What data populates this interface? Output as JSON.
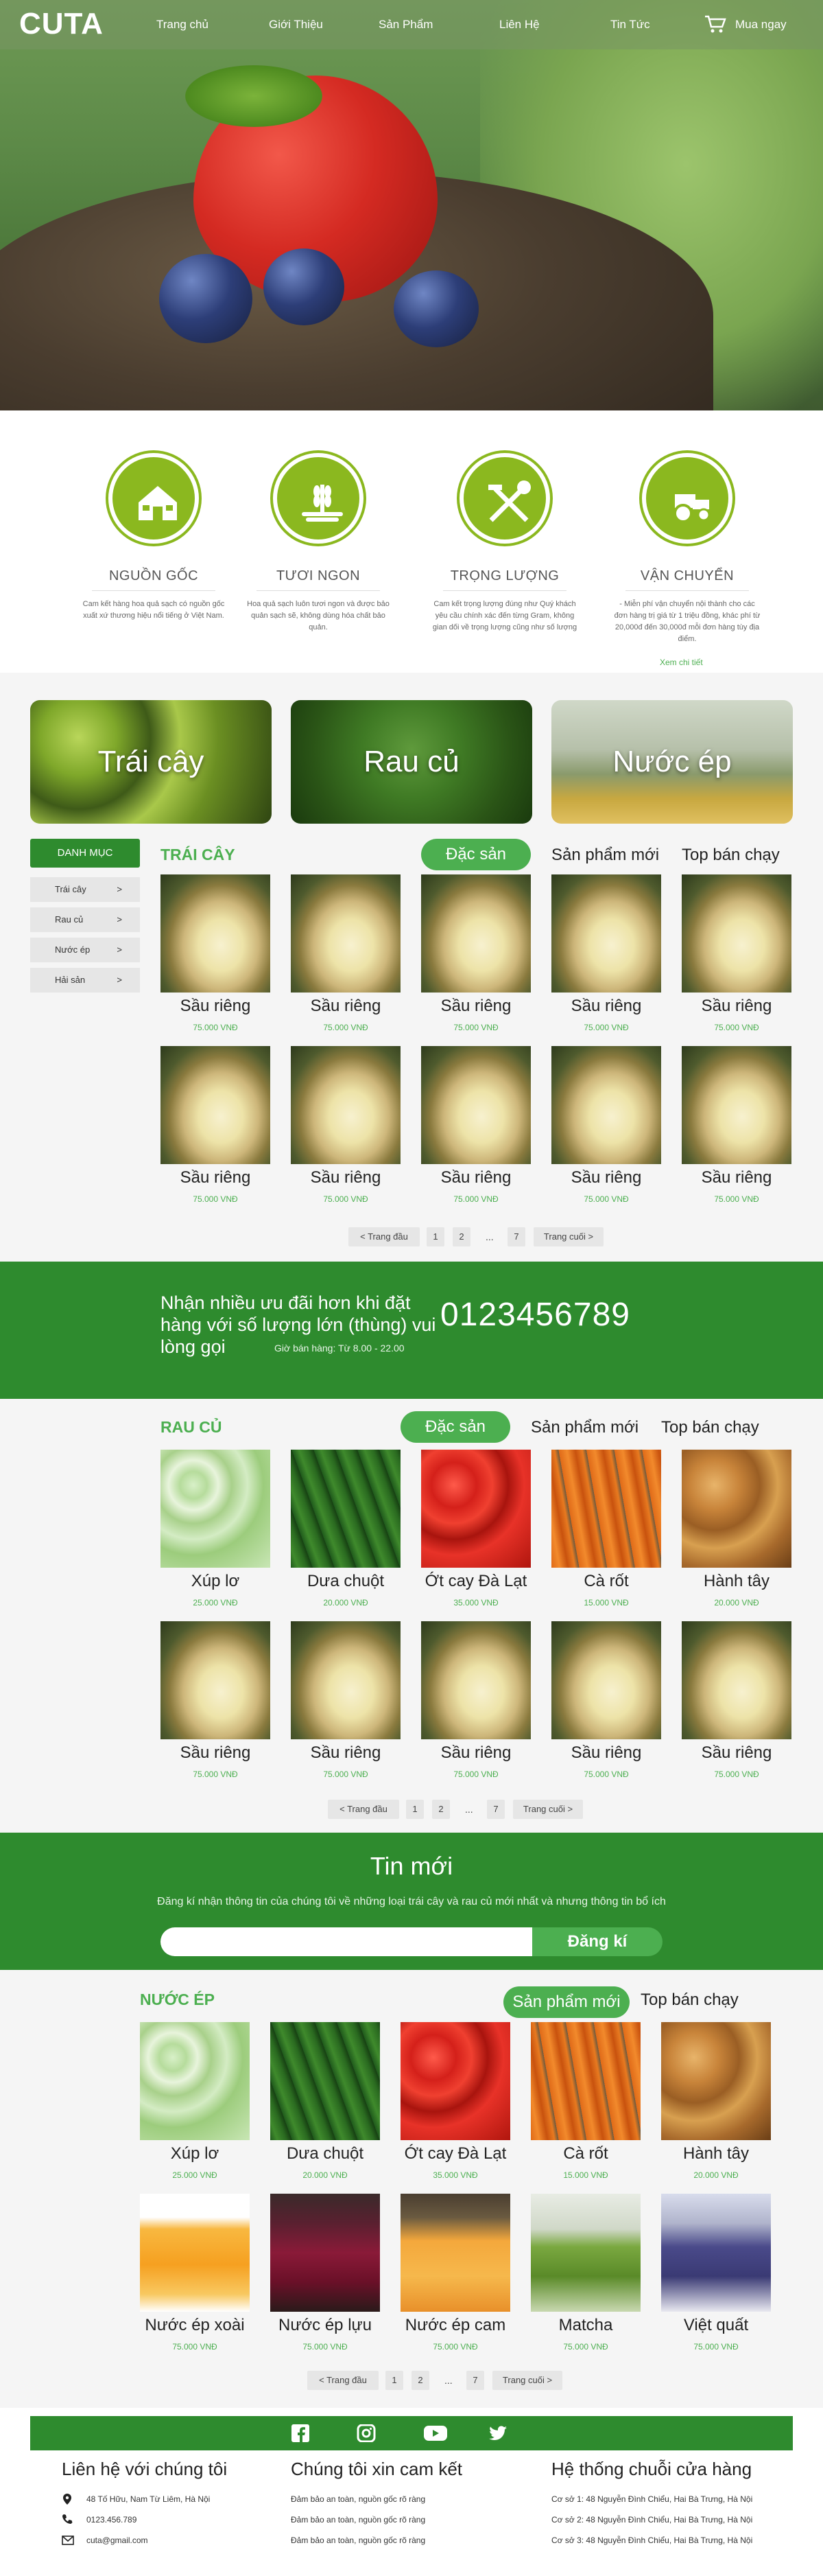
{
  "header": {
    "logo": "CUTA",
    "nav": [
      "Trang chủ",
      "Giới Thiệu",
      "Sản Phẩm",
      "Liên Hệ",
      "Tin Tức"
    ],
    "cart_label": "Mua ngay"
  },
  "features": [
    {
      "title": "NGUỒN GỐC",
      "desc": "Cam kết hàng hoa quả sạch có nguồn gốc xuất xứ thương hiệu nổi tiếng ở Việt Nam.",
      "icon": "farm-icon"
    },
    {
      "title": "TƯƠI NGON",
      "desc": "Hoa quả sạch luôn tươi ngon và được bảo quản sạch sẽ, không dùng hóa chất bảo quản.",
      "icon": "wheat-icon"
    },
    {
      "title": "TRỌNG LƯỢNG",
      "desc": "Cam kết trọng lượng đúng như Quý khách yêu cầu chính xác đến từng Gram, không gian dối về trọng lượng cũng như số lượng",
      "icon": "tools-icon"
    },
    {
      "title": "VẬN CHUYỂN",
      "desc": "- Miễn phí vận chuyển nội thành cho các đơn hàng trị giá từ 1 triệu đồng, khác phí từ 20,000đ đến 30,000đ mỗi đơn hàng tùy địa điểm.",
      "icon": "tractor-icon"
    }
  ],
  "features_more": "Xem chi tiết",
  "banners": [
    "Trái cây",
    "Rau củ",
    "Nước ép"
  ],
  "sidebar": {
    "title": "DANH MỤC",
    "items": [
      "Trái cây",
      "Rau củ",
      "Nước ép",
      "Hải sản"
    ],
    "arrow": ">"
  },
  "fruit_section": {
    "title": "TRÁI CÂY",
    "tabs": [
      "Đặc sản",
      "Sản phẩm mới",
      "Top bán chạy"
    ],
    "products": [
      {
        "name": "Sầu riêng",
        "price": "75.000 VNĐ"
      },
      {
        "name": "Sầu riêng",
        "price": "75.000 VNĐ"
      },
      {
        "name": "Sầu riêng",
        "price": "75.000 VNĐ"
      },
      {
        "name": "Sầu riêng",
        "price": "75.000 VNĐ"
      },
      {
        "name": "Sầu riêng",
        "price": "75.000 VNĐ"
      },
      {
        "name": "Sầu riêng",
        "price": "75.000 VNĐ"
      },
      {
        "name": "Sầu riêng",
        "price": "75.000 VNĐ"
      },
      {
        "name": "Sầu riêng",
        "price": "75.000 VNĐ"
      },
      {
        "name": "Sầu riêng",
        "price": "75.000 VNĐ"
      },
      {
        "name": "Sầu riêng",
        "price": "75.000 VNĐ"
      }
    ]
  },
  "pagination": {
    "first": "< Trang đầu",
    "p1": "1",
    "p2": "2",
    "dots": "...",
    "p7": "7",
    "last": "Trang cuối >"
  },
  "promo": {
    "text": "Nhận nhiều ưu đãi hơn khi đặt hàng với số lượng lớn (thùng) vui lòng gọi",
    "phone": "0123456789",
    "hours": "Giờ bán hàng: Từ 8.00 - 22.00"
  },
  "veg_section": {
    "title": "RAU CỦ",
    "tabs": [
      "Đặc sản",
      "Sản phẩm mới",
      "Top bán chạy"
    ],
    "products": [
      {
        "name": "Xúp lơ",
        "price": "25.000 VNĐ",
        "img": "broccoli"
      },
      {
        "name": "Dưa chuột",
        "price": "20.000 VNĐ",
        "img": "cucumber"
      },
      {
        "name": "Ớt cay Đà Lạt",
        "price": "35.000 VNĐ",
        "img": "pepper"
      },
      {
        "name": "Cà rốt",
        "price": "15.000 VNĐ",
        "img": "carrot"
      },
      {
        "name": "Hành tây",
        "price": "20.000 VNĐ",
        "img": "onion"
      },
      {
        "name": "Sầu riêng",
        "price": "75.000 VNĐ",
        "img": "durian"
      },
      {
        "name": "Sầu riêng",
        "price": "75.000 VNĐ",
        "img": "durian"
      },
      {
        "name": "Sầu riêng",
        "price": "75.000 VNĐ",
        "img": "durian"
      },
      {
        "name": "Sầu riêng",
        "price": "75.000 VNĐ",
        "img": "durian"
      },
      {
        "name": "Sầu riêng",
        "price": "75.000 VNĐ",
        "img": "durian"
      }
    ]
  },
  "newsletter": {
    "title": "Tin mới",
    "subtitle": "Đăng kí nhận thông tin của chúng tôi về những loại trái cây và rau củ mới nhất và nhưng thông tin bổ ích",
    "button": "Đăng kí",
    "placeholder": ""
  },
  "juice_section": {
    "title": "NƯỚC ÉP",
    "tabs": [
      "Sản phẩm mới",
      "Top bán chạy"
    ],
    "products": [
      {
        "name": "Xúp lơ",
        "price": "25.000 VNĐ",
        "img": "broccoli"
      },
      {
        "name": "Dưa chuột",
        "price": "20.000 VNĐ",
        "img": "cucumber"
      },
      {
        "name": "Ớt cay Đà Lạt",
        "price": "35.000 VNĐ",
        "img": "pepper"
      },
      {
        "name": "Cà rốt",
        "price": "15.000 VNĐ",
        "img": "carrot"
      },
      {
        "name": "Hành tây",
        "price": "20.000 VNĐ",
        "img": "onion"
      },
      {
        "name": "Nước ép xoài",
        "price": "75.000 VNĐ",
        "img": "mango"
      },
      {
        "name": "Nước ép lựu",
        "price": "75.000 VNĐ",
        "img": "pomegranate"
      },
      {
        "name": "Nước ép cam",
        "price": "75.000 VNĐ",
        "img": "orange"
      },
      {
        "name": "Matcha",
        "price": "75.000 VNĐ",
        "img": "matcha"
      },
      {
        "name": "Việt quất",
        "price": "75.000 VNĐ",
        "img": "blueberry"
      }
    ]
  },
  "footer": {
    "social": [
      "facebook-icon",
      "instagram-icon",
      "youtube-icon",
      "twitter-icon"
    ],
    "contact_title": "Liên hệ với chúng tôi",
    "address": "48 Tố Hữu, Nam Từ Liêm, Hà Nội",
    "phone": "0123.456.789",
    "email": "cuta@gmail.com",
    "commit_title": "Chúng tôi xin cam kết",
    "commits": [
      "Đảm bảo an toàn, nguồn gốc rõ ràng",
      "Đảm bảo an toàn, nguồn gốc rõ ràng",
      "Đảm bảo an toàn, nguồn gốc rõ ràng"
    ],
    "stores_title": "Hệ thống chuỗi cửa hàng",
    "stores": [
      "Cơ sở 1: 48 Nguyễn Đình Chiểu, Hai Bà Trưng, Hà Nội",
      "Cơ sở 2: 48 Nguyễn Đình Chiểu, Hai Bà Trưng, Hà Nội",
      "Cơ sở 3: 48 Nguyễn Đình Chiểu, Hai Bà Trưng, Hà Nội"
    ]
  },
  "colors": {
    "brand_green": "#2e8b2e",
    "accent_green": "#4caf50",
    "icon_green": "#8bb81f"
  }
}
